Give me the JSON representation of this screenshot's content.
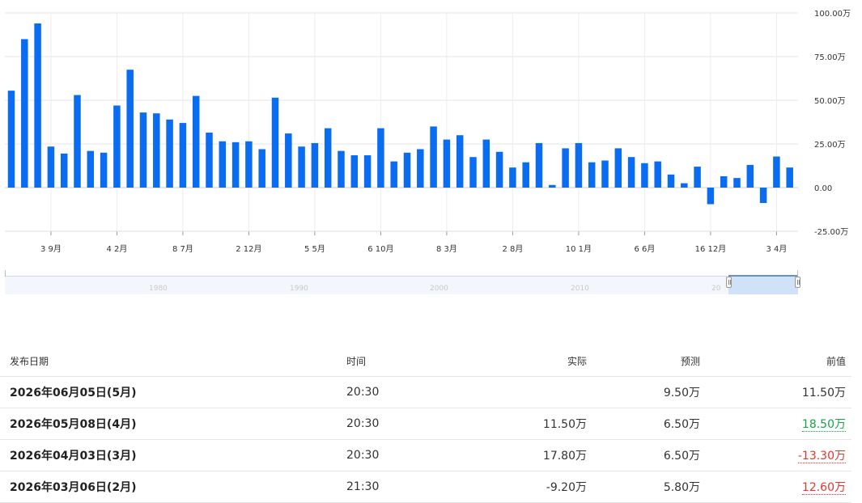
{
  "chart_data": {
    "type": "bar",
    "color": "#0a6cf1",
    "unit_suffix": "万",
    "ylim": [
      -25,
      100
    ],
    "y_ticks": [
      -25,
      0,
      25,
      50,
      75,
      100
    ],
    "y_tick_labels": [
      "-25.00万",
      "0.00",
      "25.00万",
      "50.00万",
      "75.00万",
      "100.00万"
    ],
    "x_tick_labels": [
      "3 9月",
      "4 2月",
      "8 7月",
      "2 12月",
      "5 5月",
      "6 10月",
      "8 3月",
      "2 8月",
      "10 1月",
      "6 6月",
      "16 12月",
      "3 4月"
    ],
    "values": [
      55.5,
      85,
      94,
      23.5,
      19.5,
      53,
      21,
      20,
      47,
      67.5,
      43,
      42.5,
      39,
      37,
      52.5,
      31.5,
      26.5,
      26,
      26.5,
      22,
      51.5,
      31,
      23.5,
      25.5,
      34,
      21,
      18.5,
      18.5,
      34,
      15,
      20,
      22,
      35,
      27.5,
      30,
      17.5,
      27.5,
      20.5,
      11.5,
      14.5,
      25.5,
      1.5,
      22.5,
      25.5,
      14.5,
      15.5,
      22.5,
      17.5,
      14,
      15,
      7.5,
      2.5,
      12,
      -9.5,
      6.5,
      5.5,
      13,
      -8.8,
      17.8,
      11.5
    ]
  },
  "navigator": {
    "years": [
      "1980",
      "1990",
      "2000",
      "2010",
      "20"
    ]
  },
  "table": {
    "headers": {
      "date": "发布日期",
      "time": "时间",
      "actual": "实际",
      "forecast": "预测",
      "previous": "前值"
    },
    "rows": [
      {
        "date": "2026年06月05日(5月)",
        "time": "20:30",
        "actual": "",
        "forecast": "9.50万",
        "previous": "11.50万"
      },
      {
        "date": "2026年05月08日(4月)",
        "time": "20:30",
        "actual": "11.50万",
        "forecast": "6.50万",
        "previous": "18.50万"
      },
      {
        "date": "2026年04月03日(3月)",
        "time": "20:30",
        "actual": "17.80万",
        "forecast": "6.50万",
        "previous": "-13.30万"
      },
      {
        "date": "2026年03月06日(2月)",
        "time": "21:30",
        "actual": "-9.20万",
        "forecast": "5.80万",
        "previous": "12.60万"
      }
    ]
  }
}
